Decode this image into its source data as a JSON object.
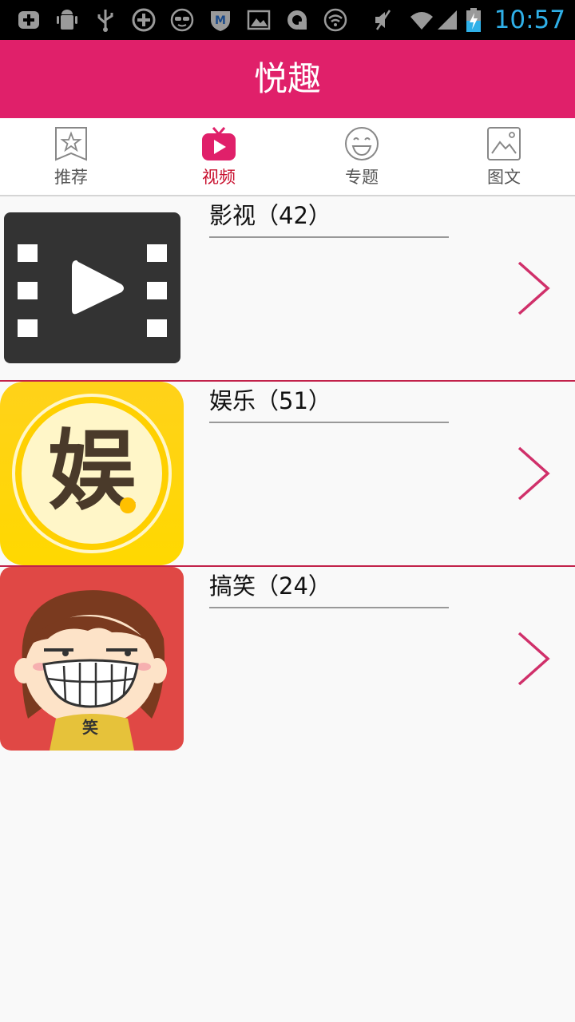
{
  "status_bar": {
    "time": "10:57",
    "icons": [
      "add-box-icon",
      "android-debug-icon",
      "usb-icon",
      "plus-circle-icon",
      "sunglasses-icon",
      "shield-m-icon",
      "picture-icon",
      "sync-icon",
      "wifi-icon",
      "mute-icon",
      "signal-icon",
      "battery-charging-icon"
    ],
    "time_color": "#2fb0e8"
  },
  "header": {
    "title": "悦趣",
    "background": "#e0206a"
  },
  "tabs": [
    {
      "label": "推荐",
      "icon": "star-bookmark-icon",
      "active": false
    },
    {
      "label": "视频",
      "icon": "tv-play-icon",
      "active": true
    },
    {
      "label": "专题",
      "icon": "smiley-icon",
      "active": false
    },
    {
      "label": "图文",
      "icon": "image-icon",
      "active": false
    }
  ],
  "list": [
    {
      "title": "影视（42）",
      "thumb": "film-play-icon"
    },
    {
      "title": "娱乐（51）",
      "thumb": "entertainment-yu-icon",
      "thumb_text": "娱"
    },
    {
      "title": "搞笑（24）",
      "thumb": "laughing-girl-icon",
      "thumb_text": "笑"
    }
  ],
  "colors": {
    "accent": "#e0206a",
    "active_tab": "#c8102e",
    "separator": "#c2224a",
    "chevron": "#d0306a"
  }
}
